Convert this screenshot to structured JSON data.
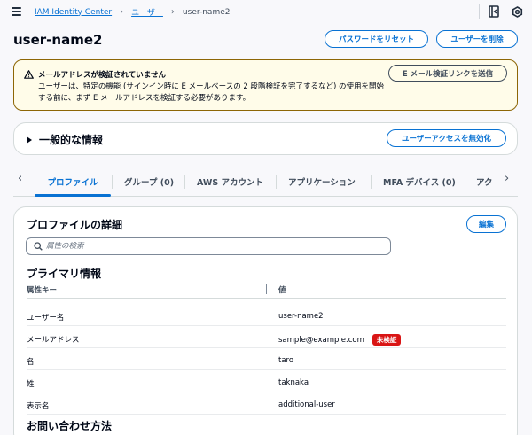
{
  "breadcrumb": {
    "items": [
      "IAM Identity Center",
      "ユーザー"
    ],
    "current": "user-name2"
  },
  "icons": [
    "menu-icon",
    "chevron-right-icon",
    "exit-panel-icon",
    "settings-icon",
    "warning-icon",
    "search-icon",
    "chevron-left-icon"
  ],
  "header": {
    "title": "user-name2",
    "reset_password_label": "パスワードをリセット",
    "delete_user_label": "ユーザーを削除"
  },
  "alert": {
    "title": "メールアドレスが検証されていません",
    "body": "ユーザーは、特定の機能 (サインイン時に E メールベースの 2 段階検証を完了するなど) の使用を開始する前に、まず E メールアドレスを検証する必要があります。",
    "action_label": "E メール検証リンクを送信"
  },
  "general": {
    "title": "一般的な情報",
    "disable_label": "ユーザーアクセスを無効化"
  },
  "tabs": [
    {
      "label": "プロファイル",
      "active": true
    },
    {
      "label": "グループ (0)",
      "active": false
    },
    {
      "label": "AWS アカウント",
      "active": false
    },
    {
      "label": "アプリケーション",
      "active": false
    },
    {
      "label": "MFA デバイス (0)",
      "active": false
    },
    {
      "label": "アク",
      "active": false
    }
  ],
  "profile": {
    "title": "プロファイルの詳細",
    "edit_label": "編集",
    "search_placeholder": "属性の検索",
    "primary_title": "プライマリ情報",
    "columns": [
      "属性キー",
      "値"
    ],
    "rows": [
      {
        "key": "ユーザー名",
        "value": "user-name2"
      },
      {
        "key": "メールアドレス",
        "value": "sample@example.com",
        "badge": "未検証"
      },
      {
        "key": "名",
        "value": "taro"
      },
      {
        "key": "姓",
        "value": "taknaka"
      },
      {
        "key": "表示名",
        "value": "additional-user"
      }
    ],
    "contact_title": "お問い合わせ方法"
  },
  "colors": {
    "link": "#0972d3",
    "warning_border": "#8d6605",
    "warning_bg": "#fffce9",
    "badge_bg": "#d91515",
    "text": "#000716"
  }
}
